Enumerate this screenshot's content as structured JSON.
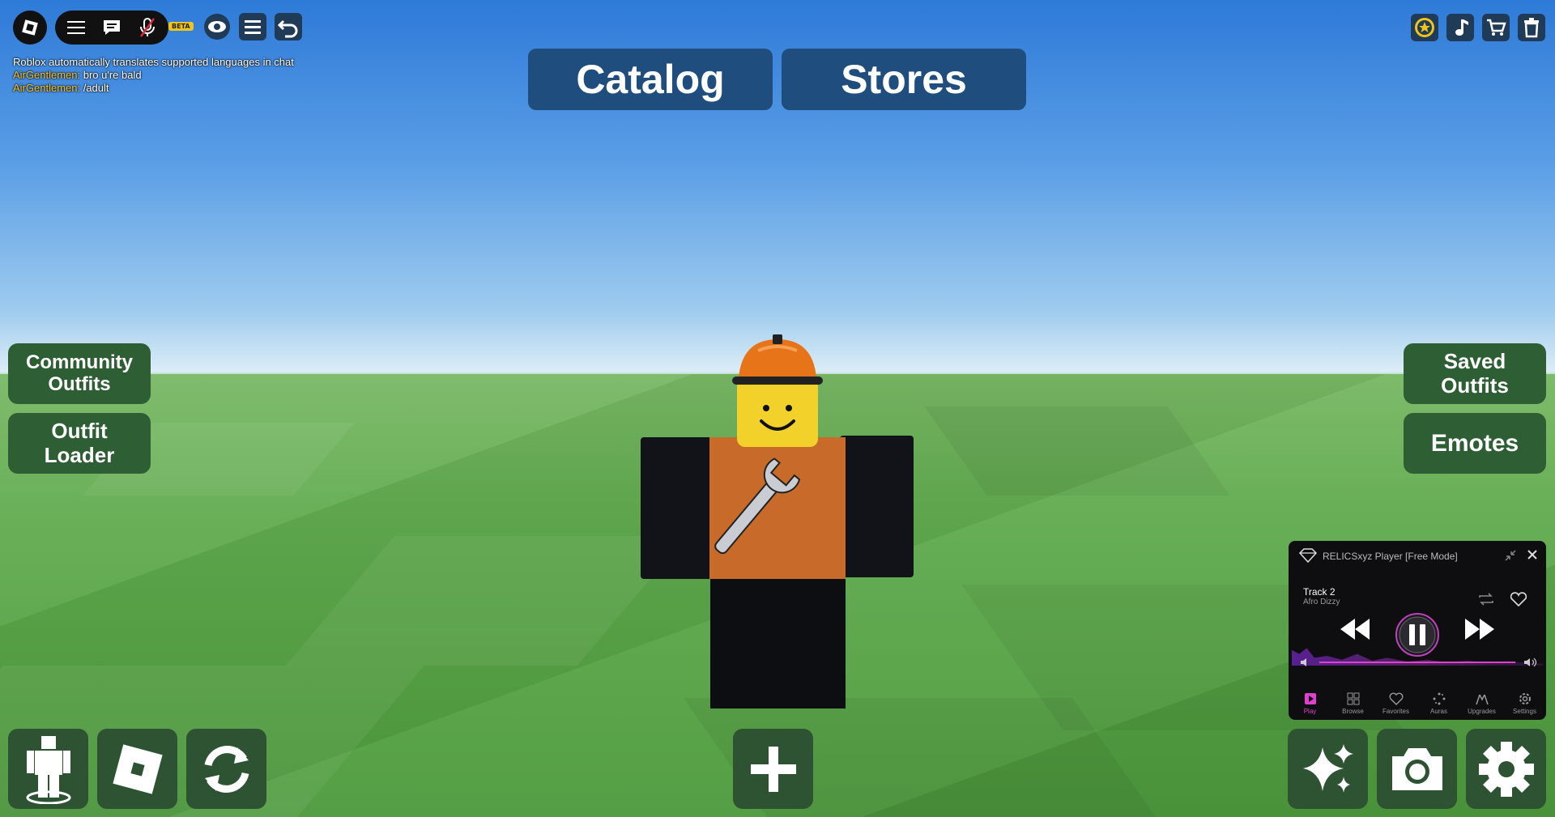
{
  "chat": {
    "system": "Roblox automatically translates supported languages in chat",
    "messages": [
      {
        "name": "AirGentlemen:",
        "text": "bro u're bald"
      },
      {
        "name": "AirGentlemen:",
        "text": "/adult"
      }
    ]
  },
  "toolbar": {
    "beta_label": "BETA"
  },
  "top_buttons": {
    "catalog": "Catalog",
    "stores": "Stores"
  },
  "left_buttons": {
    "community_outfits": "Community\nOutfits",
    "outfit_loader": "Outfit\nLoader"
  },
  "right_buttons": {
    "saved_outfits": "Saved\nOutfits",
    "emotes": "Emotes"
  },
  "player": {
    "title": "RELICSxyz Player [Free Mode]",
    "track": "Track 2",
    "artist": "Afro Dizzy",
    "accent": "#e040d0",
    "tabs": [
      {
        "label": "Play",
        "active": true
      },
      {
        "label": "Browse",
        "active": false
      },
      {
        "label": "Favorites",
        "active": false
      },
      {
        "label": "Auras",
        "active": false
      },
      {
        "label": "Upgrades",
        "active": false
      },
      {
        "label": "Settings",
        "active": false
      }
    ]
  },
  "colors": {
    "top_button_bg": "#1f4e7e",
    "side_button_bg": "#2e5e34",
    "chat_name": "#f6c230"
  }
}
